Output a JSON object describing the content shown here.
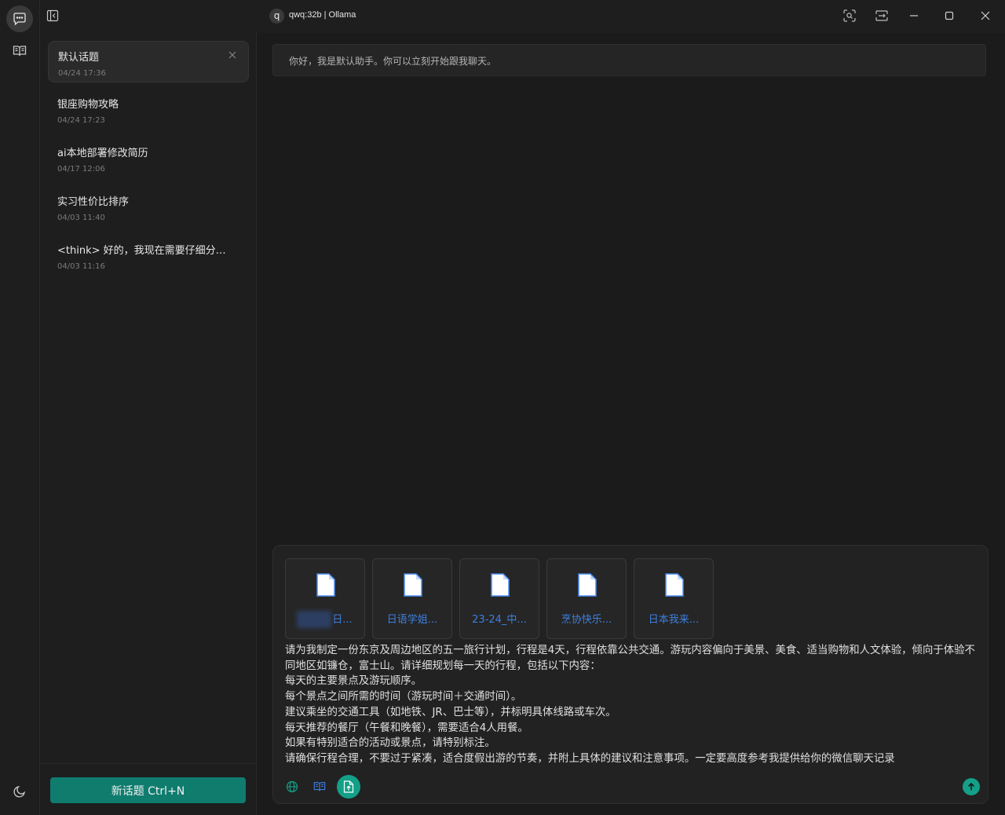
{
  "window": {
    "app_initial": "q",
    "title": "qwq:32b | Ollama"
  },
  "rail": {
    "items": [
      {
        "icon": "chat-icon",
        "active": true
      },
      {
        "icon": "book-icon",
        "active": false
      }
    ],
    "bottom_icon": "theme-moon-icon"
  },
  "sidebar": {
    "topics": [
      {
        "title": "默认话题",
        "date": "04/24 17:36",
        "active": true
      },
      {
        "title": "银座购物攻略",
        "date": "04/24 17:23",
        "active": false
      },
      {
        "title": "ai本地部署修改简历",
        "date": "04/17 12:06",
        "active": false
      },
      {
        "title": "实习性价比排序",
        "date": "04/03 11:40",
        "active": false
      },
      {
        "title": "<think> 好的，我现在需要仔细分析用户提供的内容",
        "date": "04/03 11:16",
        "active": false
      }
    ],
    "new_topic_label": "新话题 Ctrl+N"
  },
  "chat": {
    "greeting": "你好，我是默认助手。你可以立刻开始跟我聊天。"
  },
  "composer": {
    "files": [
      {
        "name": "日...",
        "redacted": true
      },
      {
        "name": "日语学姐..."
      },
      {
        "name": "23-24_中..."
      },
      {
        "name": "烹协快乐..."
      },
      {
        "name": "日本我来..."
      }
    ],
    "prompt": "请为我制定一份东京及周边地区的五一旅行计划，行程是4天，行程依靠公共交通。游玩内容偏向于美景、美食、适当购物和人文体验，倾向于体验不同地区如镰仓，富士山。请详细规划每一天的行程，包括以下内容：\n每天的主要景点及游玩顺序。\n每个景点之间所需的时间（游玩时间＋交通时间）。\n建议乘坐的交通工具（如地铁、JR、巴士等），并标明具体线路或车次。\n每天推荐的餐厅（午餐和晚餐），需要适合4人用餐。\n如果有特别适合的活动或景点，请特别标注。\n请确保行程合理，不要过于紧凑，适合度假出游的节奏，并附上具体的建议和注意事项。一定要高度参考我提供给你的微信聊天记录",
    "tools": [
      "globe-icon",
      "book-icon",
      "file-upload-icon"
    ],
    "accent_color": "#14a088"
  }
}
